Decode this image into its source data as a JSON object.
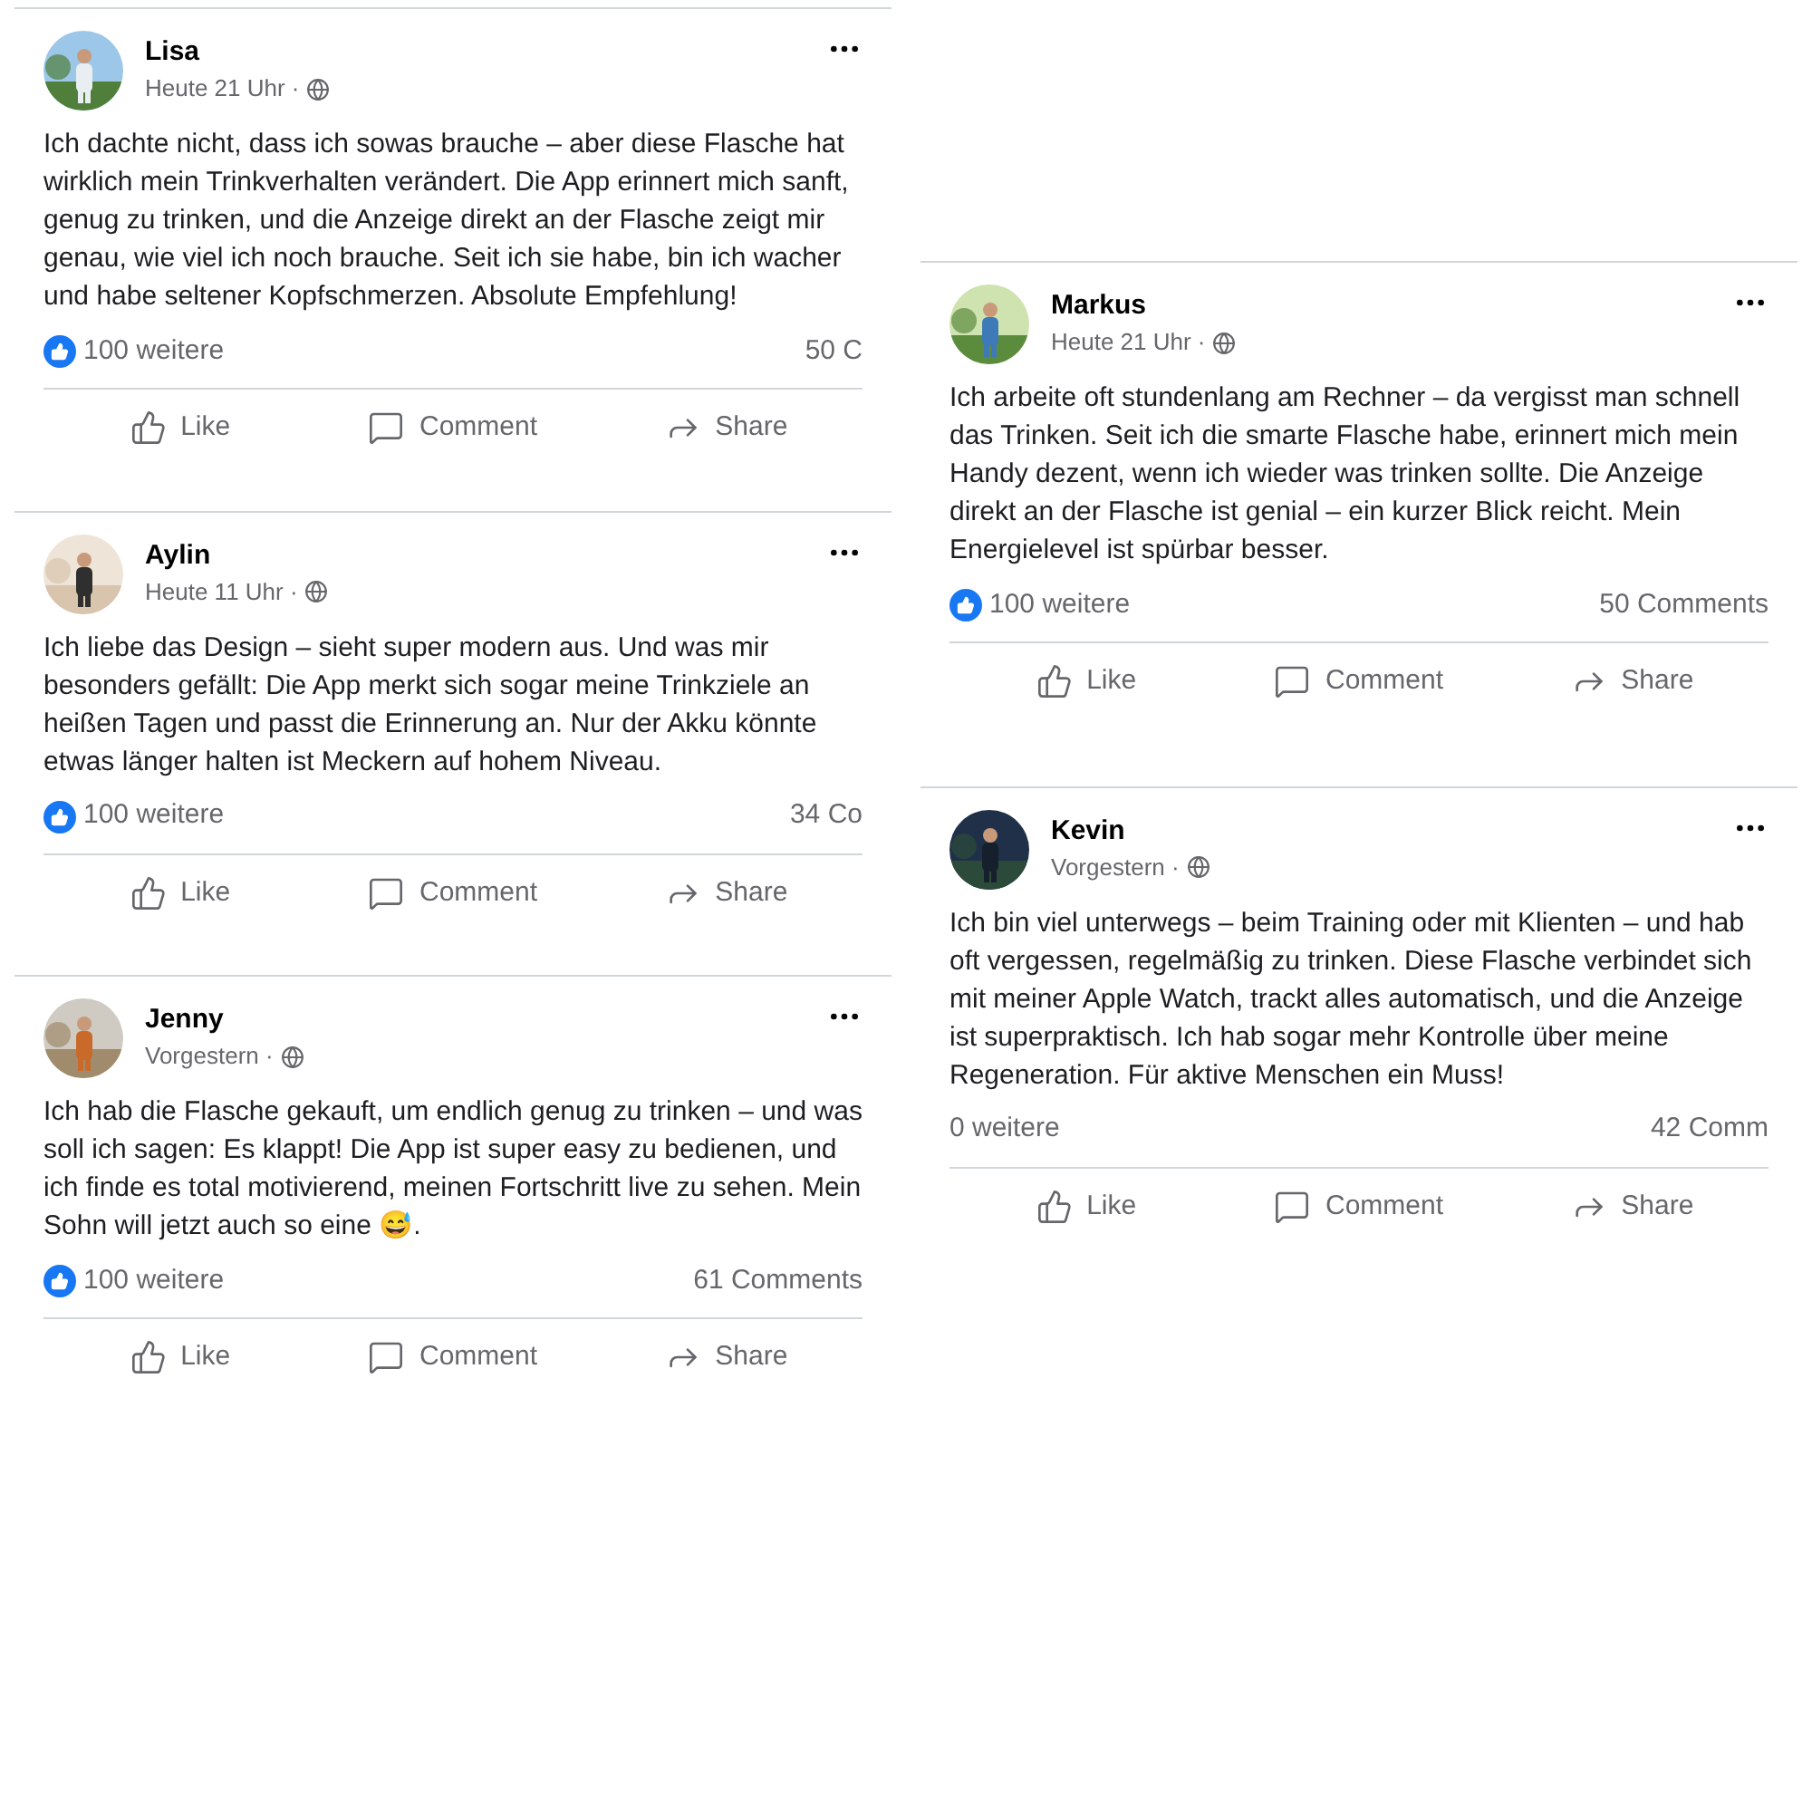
{
  "posts": [
    {
      "author": "Lisa",
      "time": "Heute 21 Uhr ·",
      "text": "Ich dachte nicht, dass ich sowas brauche – aber diese Flasche hat wirklich mein Trinkverhalten verändert. Die App erinnert mich sanft, genug zu trinken, und die Anzeige direkt an der Flasche zeigt mir genau, wie viel ich noch brauche. Seit ich sie habe, bin ich wacher und habe seltener Kopfschmerzen. Absolute Empfehlung!",
      "reactions": {
        "icon": true,
        "label": "100 weitere"
      },
      "comments": "50 C",
      "actions": [
        {
          "kind": "like",
          "label": "Like"
        },
        {
          "kind": "comment",
          "label": "Comment"
        },
        {
          "kind": "share",
          "label": "Share"
        }
      ]
    },
    {
      "author": "Markus",
      "time": "Heute 21 Uhr ·",
      "text": "Ich arbeite oft stundenlang am Rechner – da vergisst man schnell das Trinken. Seit ich die smarte Flasche habe, erinnert mich mein Handy dezent, wenn ich wieder was trinken sollte. Die Anzeige direkt an der Flasche ist genial – ein kurzer Blick reicht. Mein Energielevel ist spürbar besser.",
      "reactions": {
        "icon": true,
        "label": "100 weitere"
      },
      "comments": "50 Comments",
      "actions": [
        {
          "kind": "like",
          "label": "Like"
        },
        {
          "kind": "comment",
          "label": "Comment"
        },
        {
          "kind": "share",
          "label": "Share"
        }
      ]
    },
    {
      "author": "Aylin",
      "time": "Heute 11 Uhr ·",
      "text": "Ich liebe das Design – sieht super modern aus. Und was mir besonders gefällt: Die App merkt sich sogar meine Trinkziele an heißen Tagen und passt die Erinnerung an. Nur der Akku könnte etwas länger halten ist Meckern auf hohem Niveau.",
      "reactions": {
        "icon": true,
        "label": "100 weitere"
      },
      "comments": "34 Co",
      "actions": [
        {
          "kind": "like",
          "label": "Like"
        },
        {
          "kind": "comment",
          "label": "Comment"
        },
        {
          "kind": "share",
          "label": "Share"
        }
      ]
    },
    {
      "author": "Kevin",
      "time": "Vorgestern ·",
      "text": "Ich bin viel unterwegs – beim Training oder mit Klienten – und hab oft vergessen, regelmäßig zu trinken. Diese Flasche verbindet sich mit meiner Apple Watch, trackt alles automatisch, und die Anzeige ist superpraktisch. Ich hab sogar mehr Kontrolle über meine Regeneration. Für aktive Menschen ein Muss!",
      "reactions": {
        "icon": false,
        "label": "0 weitere"
      },
      "comments": "42 Comm",
      "actions": [
        {
          "kind": "like",
          "label": "Like"
        },
        {
          "kind": "comment",
          "label": "Comment"
        },
        {
          "kind": "share",
          "label": "Share"
        }
      ]
    },
    {
      "author": "Jenny",
      "time": "Vorgestern ·",
      "text": "Ich hab die Flasche gekauft, um endlich genug zu trinken – und was soll ich sagen: Es klappt! Die App ist super easy zu bedienen, und ich finde es total motivierend, meinen Fortschritt live zu sehen. Mein Sohn will jetzt auch so eine 😅.",
      "reactions": {
        "icon": true,
        "label": "100 weitere"
      },
      "comments": "61 Comments",
      "actions": [
        {
          "kind": "like",
          "label": "Like"
        },
        {
          "kind": "comment",
          "label": "Comment"
        },
        {
          "kind": "share",
          "label": "Share"
        }
      ]
    }
  ]
}
